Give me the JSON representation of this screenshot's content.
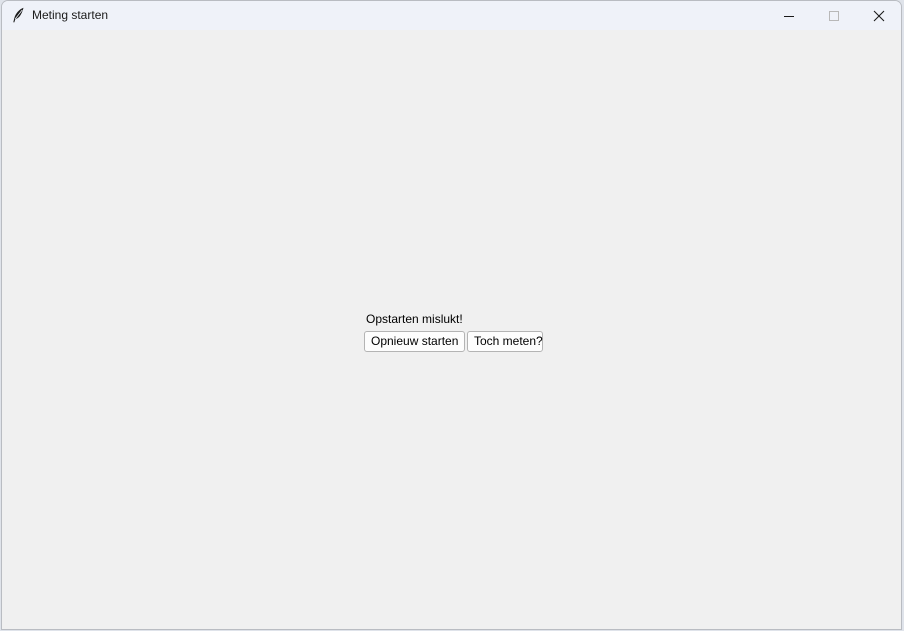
{
  "window": {
    "title": "Meting starten",
    "icons": {
      "app": "feather-icon",
      "minimize": "minimize-icon",
      "maximize": "maximize-icon",
      "close": "close-icon"
    }
  },
  "dialog": {
    "status_text": "Opstarten mislukt!",
    "restart_label": "Opnieuw starten",
    "measure_label": "Toch meten?"
  }
}
